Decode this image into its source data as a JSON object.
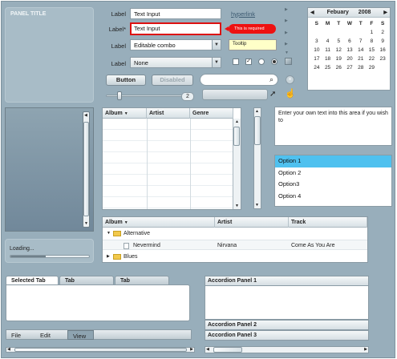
{
  "panel": {
    "title": "PANEL TITLE"
  },
  "form": {
    "label1": "Label",
    "input1": "Text Input",
    "label2": "Label*",
    "input2": "Text Input",
    "error_tip": "This is required",
    "link": "hyperlink",
    "label3": "Label",
    "combo": "Editable combo",
    "tooltip": "Tooltip",
    "label4": "Label",
    "select": "None",
    "button": "Button",
    "disabled_button": "Disabled",
    "stepper_value": "2"
  },
  "calendar": {
    "month": "Febuary",
    "year": "2008",
    "prev_icon": "◀",
    "next_icon": "▶",
    "day_names": [
      "S",
      "M",
      "T",
      "W",
      "T",
      "F",
      "S"
    ],
    "weeks": [
      [
        "",
        "",
        "",
        "",
        "",
        "1",
        "2"
      ],
      [
        "3",
        "4",
        "5",
        "6",
        "7",
        "8",
        "9"
      ],
      [
        "10",
        "11",
        "12",
        "13",
        "14",
        "15",
        "16"
      ],
      [
        "17",
        "18",
        "19",
        "20",
        "21",
        "22",
        "23"
      ],
      [
        "24",
        "25",
        "26",
        "27",
        "28",
        "29",
        ""
      ]
    ]
  },
  "grid1": {
    "columns": [
      "Album",
      "Artist",
      "Genre"
    ],
    "sort_icon": "▼"
  },
  "textarea": {
    "placeholder": "Enter your own text into this area if you wish to"
  },
  "list": {
    "items": [
      "Option 1",
      "Option 2",
      "Option3",
      "Option 4"
    ],
    "selected": 0
  },
  "tree_grid": {
    "columns": [
      "Album",
      "Artist",
      "Track"
    ],
    "rows": [
      {
        "label": "Alternative",
        "artist": "",
        "track": ""
      },
      {
        "label": "Nevermind",
        "artist": "Nirvana",
        "track": "Come As You Are"
      },
      {
        "label": "Blues",
        "artist": "",
        "track": ""
      }
    ]
  },
  "loading": {
    "label": "Loading...",
    "progress": 0.45
  },
  "tabs": [
    "Selected Tab",
    "Tab",
    "Tab"
  ],
  "menu": [
    "File",
    "Edit",
    "View"
  ],
  "accordion": [
    "Accordion Panel 1",
    "Accordion Panel 2",
    "Accordion Panel 3"
  ],
  "colors": {
    "background": "#98aebb",
    "selection": "#4fc1ef",
    "error": "#e11"
  }
}
